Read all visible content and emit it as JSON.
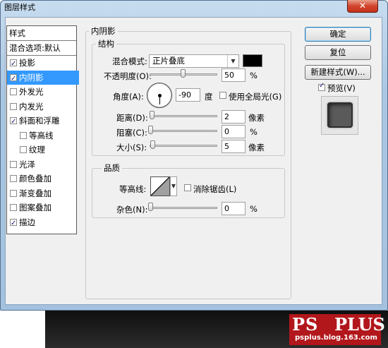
{
  "window": {
    "title": "图层样式",
    "close_glyph": "✕"
  },
  "styles_list": {
    "header": "样式",
    "blending_options": "混合选项:默认",
    "items": [
      {
        "label": "投影",
        "checked": true,
        "selected": false,
        "indent": false
      },
      {
        "label": "内阴影",
        "checked": true,
        "selected": true,
        "indent": false
      },
      {
        "label": "外发光",
        "checked": false,
        "selected": false,
        "indent": false
      },
      {
        "label": "内发光",
        "checked": false,
        "selected": false,
        "indent": false
      },
      {
        "label": "斜面和浮雕",
        "checked": true,
        "selected": false,
        "indent": false
      },
      {
        "label": "等高线",
        "checked": false,
        "selected": false,
        "indent": true
      },
      {
        "label": "纹理",
        "checked": false,
        "selected": false,
        "indent": true
      },
      {
        "label": "光泽",
        "checked": false,
        "selected": false,
        "indent": false
      },
      {
        "label": "颜色叠加",
        "checked": false,
        "selected": false,
        "indent": false
      },
      {
        "label": "渐变叠加",
        "checked": false,
        "selected": false,
        "indent": false
      },
      {
        "label": "图案叠加",
        "checked": false,
        "selected": false,
        "indent": false
      },
      {
        "label": "描边",
        "checked": true,
        "selected": false,
        "indent": false
      }
    ]
  },
  "inner_shadow": {
    "title": "内阴影",
    "structure": {
      "title": "结构",
      "blend_mode_label": "混合模式:",
      "blend_mode_value": "正片叠底",
      "blend_color": "#000000",
      "opacity_label": "不透明度(O):",
      "opacity_value": "50",
      "opacity_unit": "%",
      "opacity_level": 0.5,
      "angle_label": "角度(A):",
      "angle_value": "-90",
      "angle_unit": "度",
      "global_light_label": "使用全局光(G)",
      "global_light_checked": false,
      "distance_label": "距离(D):",
      "distance_value": "2",
      "distance_unit": "像素",
      "choke_label": "阻塞(C):",
      "choke_value": "0",
      "choke_unit": "%",
      "size_label": "大小(S):",
      "size_value": "5",
      "size_unit": "像素"
    },
    "quality": {
      "title": "品质",
      "contour_label": "等高线:",
      "anti_alias_label": "消除锯齿(L)",
      "anti_alias_checked": false,
      "noise_label": "杂色(N):",
      "noise_value": "0",
      "noise_unit": "%"
    }
  },
  "buttons": {
    "ok": "确定",
    "reset": "复位",
    "new_style": "新建样式(W)...",
    "preview_label": "预览(V)",
    "preview_checked": true
  },
  "watermark": {
    "brand_ps": "PS",
    "brand_plus": "PLUS",
    "url": "psplus.blog.163.com"
  },
  "colors": {
    "selection": "#3399ff",
    "dialog_bg": "#f0f0f0",
    "close_button": "#c7321a",
    "watermark_red": "#b2171b"
  }
}
